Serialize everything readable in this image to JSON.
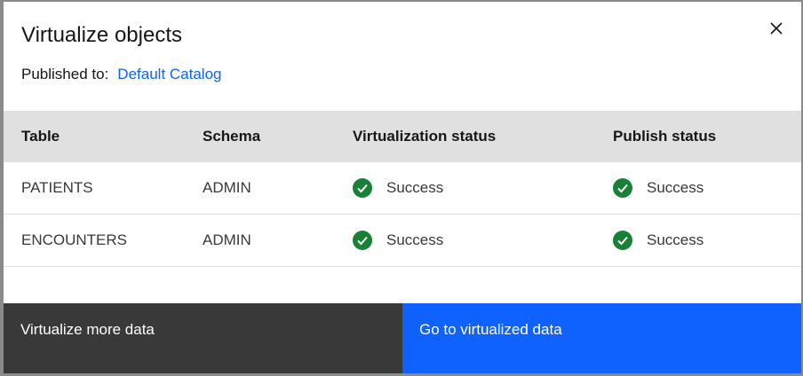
{
  "modal": {
    "title": "Virtualize objects",
    "published_label": "Published to:",
    "published_link": "Default Catalog"
  },
  "table": {
    "headers": [
      "Table",
      "Schema",
      "Virtualization status",
      "Publish status"
    ],
    "rows": [
      {
        "table": "PATIENTS",
        "schema": "ADMIN",
        "virtualization_status": "Success",
        "publish_status": "Success"
      },
      {
        "table": "ENCOUNTERS",
        "schema": "ADMIN",
        "virtualization_status": "Success",
        "publish_status": "Success"
      }
    ]
  },
  "footer": {
    "secondary_label": "Virtualize more data",
    "primary_label": "Go to virtualized data"
  },
  "icons": {
    "close": "close-icon",
    "success": "checkmark-filled-icon"
  },
  "colors": {
    "success": "#198038",
    "link": "#0f62fe",
    "primary_button": "#0f62fe",
    "secondary_button": "#393939",
    "header_bg": "#e0e0e0"
  }
}
